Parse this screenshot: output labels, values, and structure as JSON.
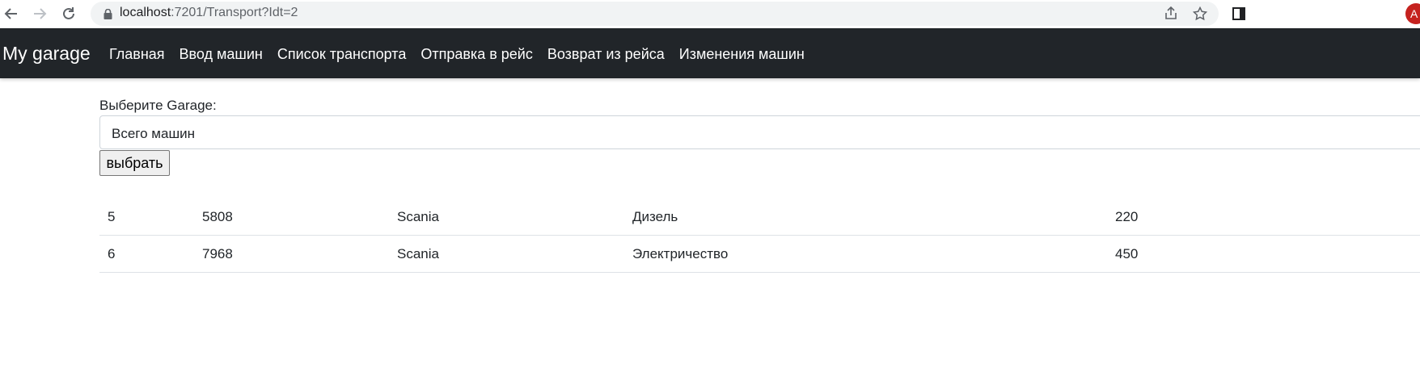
{
  "browser": {
    "url_host": "localhost",
    "url_rest": ":7201/Transport?Idt=2",
    "avatar_letter": "A",
    "accent_color": "#c5221f"
  },
  "navbar": {
    "brand": "My garage",
    "links": [
      "Главная",
      "Ввод машин",
      "Список транспорта",
      "Отправка в рейс",
      "Возврат из рейса",
      "Изменения машин"
    ],
    "background": "#212529"
  },
  "form": {
    "label": "Выберите Garage:",
    "selected_option": "Всего машин",
    "submit_label": "выбрать"
  },
  "table": {
    "rows": [
      [
        "5",
        "5808",
        "Scania",
        "Дизель",
        "220"
      ],
      [
        "6",
        "7968",
        "Scania",
        "Электричество",
        "450"
      ]
    ]
  },
  "icons": {
    "back": "arrow-left-icon",
    "forward": "arrow-right-icon",
    "reload": "reload-icon",
    "lock": "lock-icon",
    "share": "share-icon",
    "bookmark": "star-icon",
    "side_panel": "side-panel-icon"
  }
}
